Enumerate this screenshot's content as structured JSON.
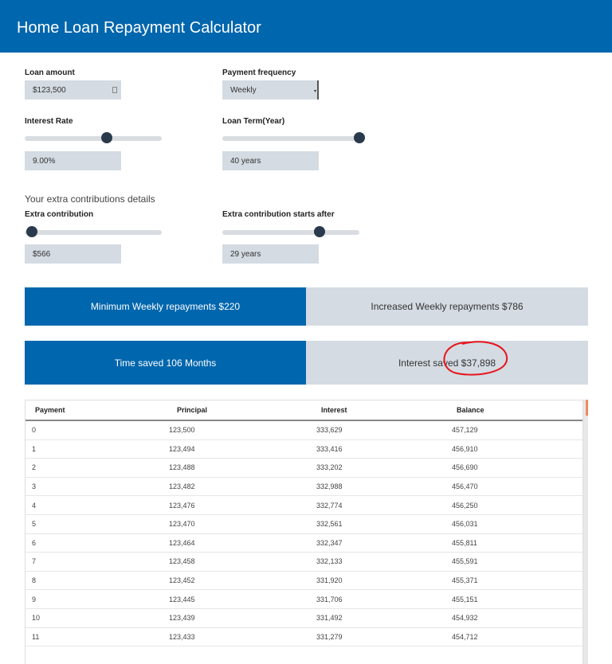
{
  "title": "Home Loan Repayment Calculator",
  "form": {
    "loan_amount_label": "Loan amount",
    "loan_amount": "$123,500",
    "payment_frequency_label": "Payment frequency",
    "payment_frequency": "Weekly",
    "interest_rate_label": "Interest Rate",
    "interest_rate": "9.00%",
    "interest_rate_slider": 0.6,
    "loan_term_label": "Loan Term(Year)",
    "loan_term": "40 years",
    "loan_term_slider": 1.0,
    "extra_heading": "Your extra contributions details",
    "extra_contribution_label": "Extra contribution",
    "extra_contribution": "$566",
    "extra_contribution_slider": 0.05,
    "extra_start_label": "Extra contribution starts after",
    "extra_start": "29 years",
    "extra_start_slider": 0.71
  },
  "summary": {
    "min_repayments": "Minimum Weekly repayments $220",
    "increased_repayments": "Increased Weekly repayments $786",
    "time_saved": "Time saved 106 Months",
    "interest_saved": "Interest saved $37,898"
  },
  "table": {
    "headers": [
      "Payment",
      "Principal",
      "Interest",
      "Balance"
    ],
    "rows": [
      [
        "0",
        "123,500",
        "333,629",
        "457,129"
      ],
      [
        "1",
        "123,494",
        "333,416",
        "456,910"
      ],
      [
        "2",
        "123,488",
        "333,202",
        "456,690"
      ],
      [
        "3",
        "123,482",
        "332,988",
        "456,470"
      ],
      [
        "4",
        "123,476",
        "332,774",
        "456,250"
      ],
      [
        "5",
        "123,470",
        "332,561",
        "456,031"
      ],
      [
        "6",
        "123,464",
        "332,347",
        "455,811"
      ],
      [
        "7",
        "123,458",
        "332,133",
        "455,591"
      ],
      [
        "8",
        "123,452",
        "331,920",
        "455,371"
      ],
      [
        "9",
        "123,445",
        "331,706",
        "455,151"
      ],
      [
        "10",
        "123,439",
        "331,492",
        "454,932"
      ],
      [
        "11",
        "123,433",
        "331,279",
        "454,712"
      ]
    ]
  },
  "colors": {
    "primary": "#0066ad",
    "annotation": "#e8141c"
  }
}
